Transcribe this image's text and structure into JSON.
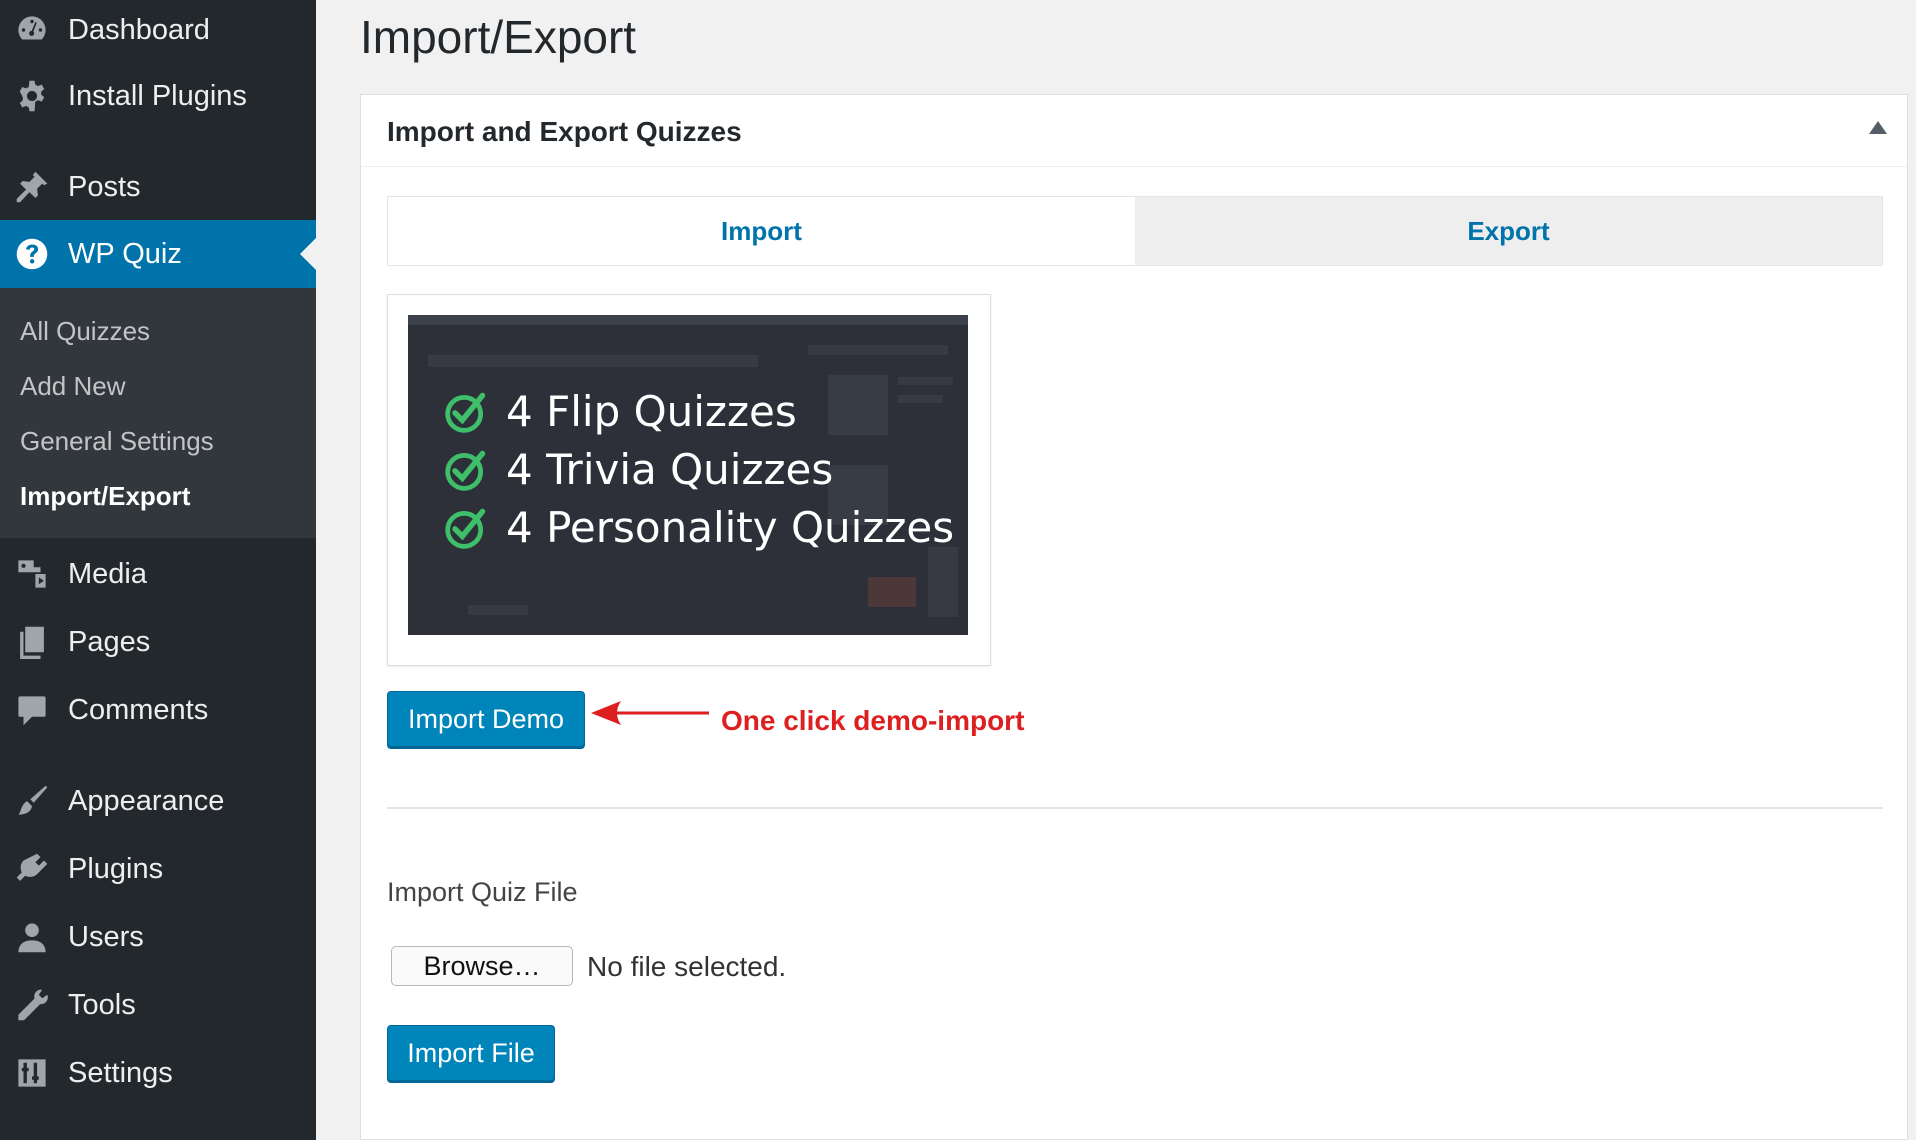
{
  "sidebar": {
    "top_items": [
      {
        "label": "Dashboard",
        "icon": "dashboard-icon"
      },
      {
        "label": "Install Plugins",
        "icon": "gear-icon"
      },
      {
        "label": "Posts",
        "icon": "pushpin-icon"
      },
      {
        "label": "WP Quiz",
        "icon": "question-circle-icon",
        "active": true
      }
    ],
    "submenu": [
      "All Quizzes",
      "Add New",
      "General Settings",
      "Import/Export"
    ],
    "current_submenu": "Import/Export",
    "bottom_items": [
      {
        "label": "Media",
        "icon": "media-icon"
      },
      {
        "label": "Pages",
        "icon": "pages-icon"
      },
      {
        "label": "Comments",
        "icon": "comment-icon"
      },
      {
        "label": "Appearance",
        "icon": "paintbrush-icon"
      },
      {
        "label": "Plugins",
        "icon": "plugin-icon"
      },
      {
        "label": "Users",
        "icon": "user-icon"
      },
      {
        "label": "Tools",
        "icon": "wrench-icon"
      },
      {
        "label": "Settings",
        "icon": "settings-sliders-icon"
      }
    ]
  },
  "page": {
    "title": "Import/Export"
  },
  "panel": {
    "title": "Import and Export Quizzes",
    "tabs": [
      {
        "label": "Import",
        "selected": true
      },
      {
        "label": "Export",
        "selected": false
      }
    ],
    "demo_image": {
      "lines": [
        "4 Flip Quizzes",
        "4 Trivia Quizzes",
        "4 Personality Quizzes"
      ],
      "check_color": "#3fbf6a"
    },
    "import_demo_button": "Import Demo",
    "annotation": "One click demo-import",
    "import_file_label": "Import Quiz File",
    "browse_button": "Browse…",
    "file_status": "No file selected.",
    "import_file_button": "Import File"
  },
  "colors": {
    "sidebar_bg": "#23282d",
    "active_menu": "#0073aa",
    "primary_button": "#0085ba",
    "annotation": "#dd1f1f"
  }
}
